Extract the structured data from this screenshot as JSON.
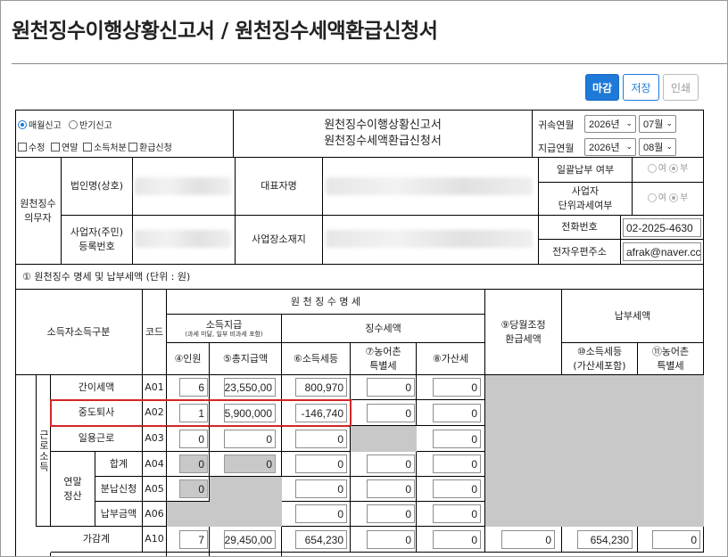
{
  "page": {
    "title": "원천징수이행상황신고서 / 원천징수세액환급신청서"
  },
  "toolbar": {
    "close_label": "마감",
    "save_label": "저장",
    "print_label": "인쇄"
  },
  "header": {
    "report_monthly": "매월신고",
    "report_half": "반기신고",
    "chk_modify": "수정",
    "chk_yearend": "연말",
    "chk_income_disposal": "소득처분",
    "chk_refund": "환급신청",
    "form_title_1": "원천징수이행상황신고서",
    "form_title_2": "원천징수세액환급신청서",
    "belong_label": "귀속연월",
    "belong_year": "2026년",
    "belong_month": "07월",
    "pay_label": "지급연월",
    "pay_year": "2026년",
    "pay_month": "08월"
  },
  "obligor": {
    "section_label": "원천징수\n의무자",
    "corp_name_label": "법인명(상호)",
    "rep_label": "대표자명",
    "biz_no_label": "사업자(주민)\n등록번호",
    "address_label": "사업장소재지",
    "bulk_pay_label": "일괄납부 여부",
    "unit_tax_label": "사업자\n단위과세여부",
    "yes": "여",
    "no": "부",
    "phone_label": "전화번호",
    "phone_value": "02-2025-4630",
    "email_label": "전자우편주소",
    "email_value": "afrak@naver.cc"
  },
  "section1": {
    "title": "① 원천징수 명세 및 납부세액 (단위 : 원)"
  },
  "table": {
    "h_income_class": "소득자소득구분",
    "h_code": "코드",
    "h_detail": "원 천 징 수 명 세",
    "h_pay": "소득지급",
    "h_pay_sub": "(과세 미달, 일부 비과세 포함)",
    "h_tax": "징수세액",
    "h_adjust": "⑨당월조정\n환급세액",
    "h_payment": "납부세액",
    "h_count": "④인원",
    "h_total_pay": "⑤총지급액",
    "h_income_tax": "⑥소득세등",
    "h_rural": "⑦농어촌\n특별세",
    "h_additional": "⑧가산세",
    "h_pay_income_tax": "⑩소득세등\n(가산세포함)",
    "h_pay_rural": "⑪농어촌\n특별세",
    "group_label": "근로소득",
    "yearend_label": "연말\n정산",
    "rows": [
      {
        "name": "간이세액",
        "code": "A01",
        "count": "6",
        "pay": "23,550,00",
        "tax": "800,970",
        "rural": "0",
        "add": "0"
      },
      {
        "name": "중도퇴사",
        "code": "A02",
        "count": "1",
        "pay": "5,900,000",
        "tax": "-146,740",
        "rural": "0",
        "add": "0"
      },
      {
        "name": "일용근로",
        "code": "A03",
        "count": "0",
        "pay": "0",
        "tax": "0",
        "add": "0"
      },
      {
        "name": "합계",
        "code": "A04",
        "count": "0",
        "pay": "0",
        "tax": "0",
        "rural": "0",
        "add": "0"
      },
      {
        "name": "분납신청",
        "code": "A05",
        "count": "0",
        "tax": "0",
        "rural": "0",
        "add": "0"
      },
      {
        "name": "납부금액",
        "code": "A06",
        "tax": "0",
        "rural": "0",
        "add": "0"
      },
      {
        "name": "가감계",
        "code": "A10",
        "count": "7",
        "pay": "29,450,00",
        "tax": "654,230",
        "rural": "0",
        "add": "0",
        "adjust": "0",
        "pay_tax": "654,230",
        "pay_rural": "0"
      }
    ]
  }
}
